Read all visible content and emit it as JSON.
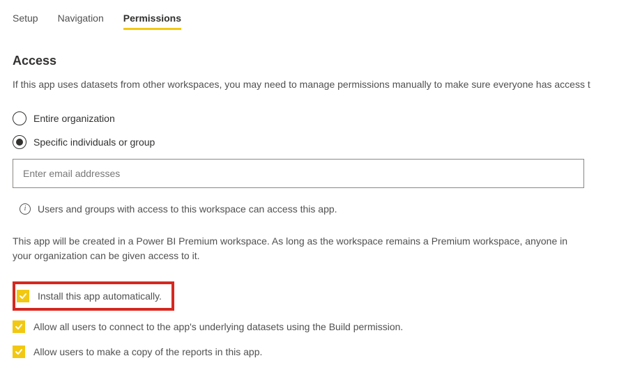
{
  "tabs": {
    "setup": "Setup",
    "navigation": "Navigation",
    "permissions": "Permissions"
  },
  "section": {
    "title": "Access",
    "intro": "If this app uses datasets from other workspaces, you may need to manage permissions manually to make sure everyone has access t"
  },
  "radio": {
    "entire_org": "Entire organization",
    "specific": "Specific individuals or group"
  },
  "email_input": {
    "placeholder": "Enter email addresses"
  },
  "info": {
    "text": "Users and groups with access to this workspace can access this app."
  },
  "premium_text": "This app will be created in a Power BI Premium workspace. As long as the workspace remains a Premium workspace, anyone in your organization can be given access to it.",
  "checkboxes": {
    "install_auto": "Install this app automatically.",
    "build_permission": "Allow all users to connect to the app's underlying datasets using the Build permission.",
    "copy_reports": "Allow users to make a copy of the reports in this app."
  }
}
